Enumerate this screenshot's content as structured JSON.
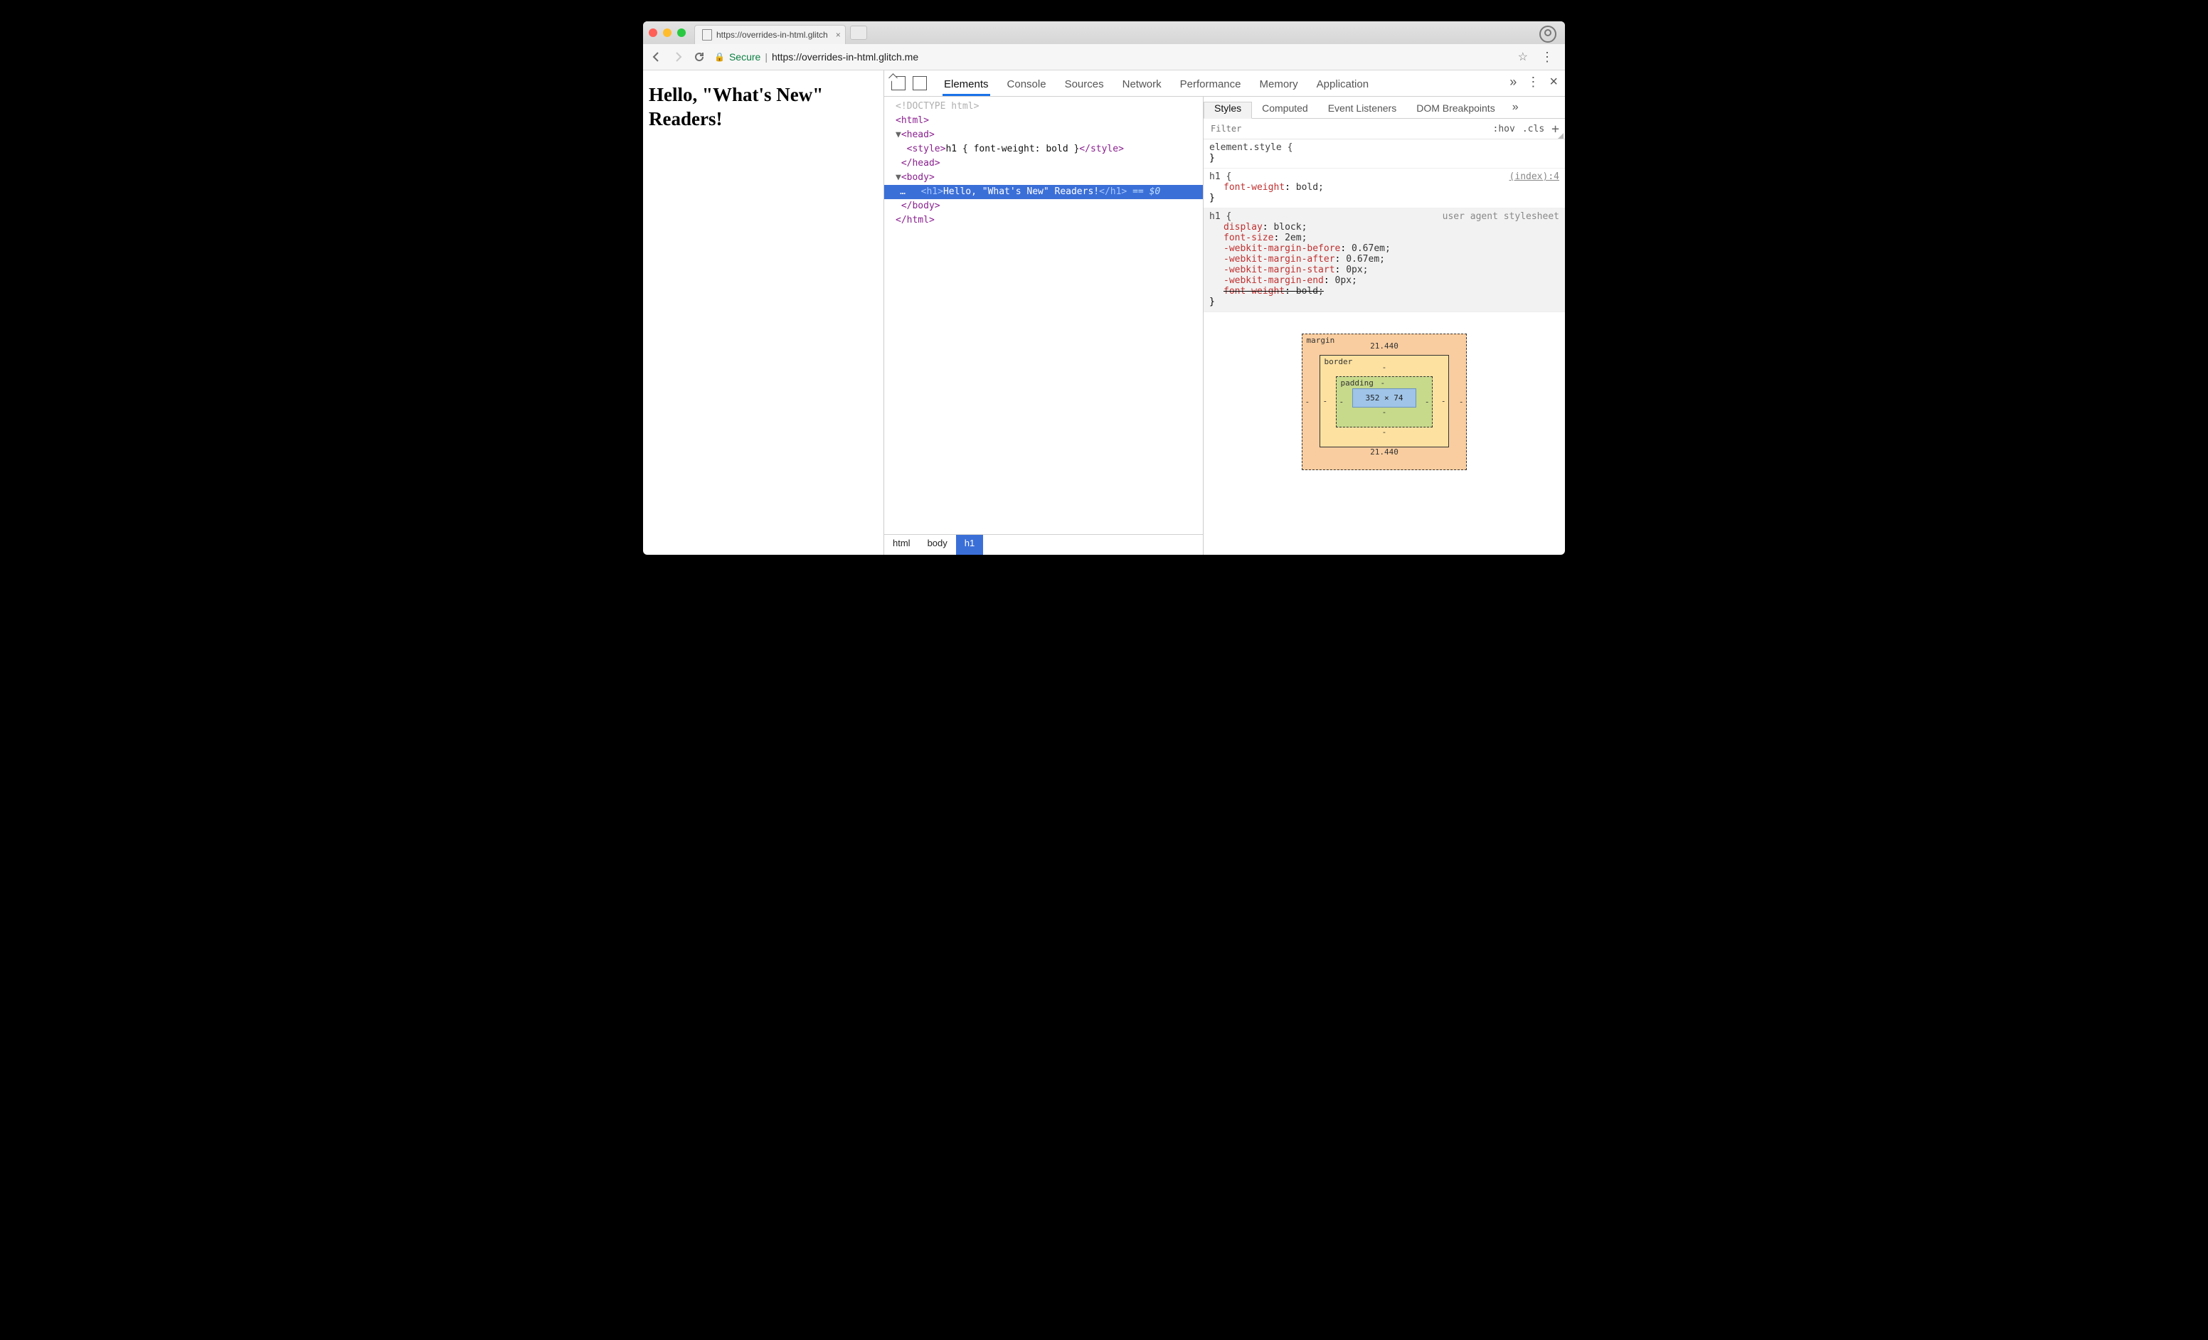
{
  "browser": {
    "tab_title": "https://overrides-in-html.glitch",
    "secure_label": "Secure",
    "url_display": "https://overrides-in-html.glitch.me"
  },
  "page": {
    "h1": "Hello, \"What's New\" Readers!"
  },
  "devtools": {
    "tabs": [
      "Elements",
      "Console",
      "Sources",
      "Network",
      "Performance",
      "Memory",
      "Application"
    ],
    "active_tab": "Elements",
    "dom_lines": {
      "l0": "<!DOCTYPE html>",
      "l1": "<html>",
      "l2_open": "<head>",
      "l3_style_open": "<style>",
      "l3_style_text": "h1 { font-weight: bold }",
      "l3_style_close": "</style>",
      "l4": "</head>",
      "l5_open": "<body>",
      "l6_open": "<h1>",
      "l6_text": "Hello, \"What's New\" Readers!",
      "l6_close": "</h1>",
      "l6_marker": " == $0",
      "l7": "</body>",
      "l8": "</html>",
      "ellipsis": "…"
    },
    "crumbs": [
      "html",
      "body",
      "h1"
    ],
    "styles": {
      "subtabs": [
        "Styles",
        "Computed",
        "Event Listeners",
        "DOM Breakpoints"
      ],
      "filter_placeholder": "Filter",
      "hov_label": ":hov",
      "cls_label": ".cls",
      "rules": [
        {
          "selector": "element.style {",
          "close": "}",
          "source": "",
          "props": []
        },
        {
          "selector": "h1 {",
          "close": "}",
          "source": "(index):4",
          "source_underline": true,
          "props": [
            {
              "k": "font-weight",
              "v": "bold;"
            }
          ]
        },
        {
          "selector": "h1 {",
          "close": "}",
          "source": "user agent stylesheet",
          "ua": true,
          "props": [
            {
              "k": "display",
              "v": "block;"
            },
            {
              "k": "font-size",
              "v": "2em;"
            },
            {
              "k": "-webkit-margin-before",
              "v": "0.67em;"
            },
            {
              "k": "-webkit-margin-after",
              "v": "0.67em;"
            },
            {
              "k": "-webkit-margin-start",
              "v": "0px;"
            },
            {
              "k": "-webkit-margin-end",
              "v": "0px;"
            },
            {
              "k": "font-weight",
              "v": "bold;",
              "strike": true
            }
          ]
        }
      ],
      "boxmodel": {
        "margin_label": "margin",
        "margin_top": "21.440",
        "margin_right": "-",
        "margin_bottom": "21.440",
        "margin_left": "-",
        "border_label": "border",
        "border_val": "-",
        "padding_label": "padding",
        "padding_val": "-",
        "content": "352 × 74"
      }
    }
  }
}
